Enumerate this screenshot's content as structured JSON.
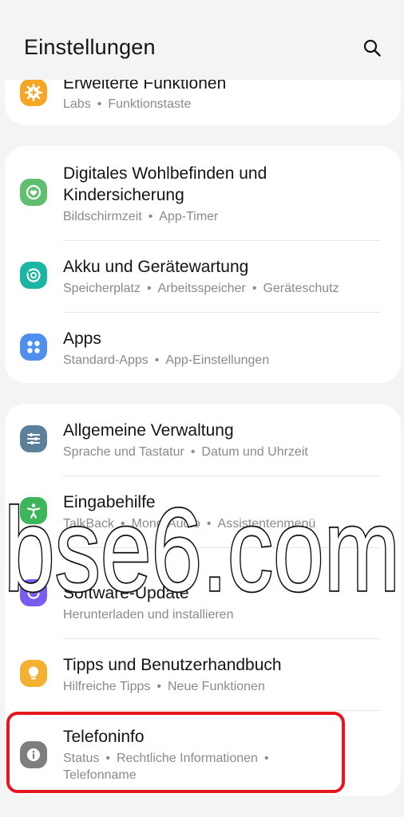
{
  "header": {
    "title": "Einstellungen",
    "search_icon": "search-icon"
  },
  "card1": {
    "item": {
      "label": "Erweiterte Funktionen",
      "subs": [
        "Labs",
        "Funktionstaste"
      ],
      "icon": "gear-plus-icon",
      "color": "#f5a623"
    }
  },
  "card2": {
    "items": [
      {
        "label_line1": "Digitales Wohlbefinden und",
        "label_line2": "Kindersicherung",
        "subs": [
          "Bildschirmzeit",
          "App-Timer"
        ],
        "icon": "wellbeing-icon",
        "color": "#5fbf6f"
      },
      {
        "label": "Akku und Gerätewartung",
        "subs": [
          "Speicherplatz",
          "Arbeitsspeicher",
          "Geräteschutz"
        ],
        "icon": "device-care-icon",
        "color": "#1bb5a3"
      },
      {
        "label": "Apps",
        "subs": [
          "Standard-Apps",
          "App-Einstellungen"
        ],
        "icon": "apps-icon",
        "color": "#4f8ff0"
      }
    ]
  },
  "card3": {
    "items": [
      {
        "label": "Allgemeine Verwaltung",
        "subs": [
          "Sprache und Tastatur",
          "Datum und Uhrzeit"
        ],
        "icon": "sliders-icon",
        "color": "#5c7f9a"
      },
      {
        "label": "Eingabehilfe",
        "subs": [
          "TalkBack",
          "Mono-Audio",
          "Assistentenmenü"
        ],
        "icon": "accessibility-icon",
        "color": "#3db55a"
      },
      {
        "label": "Software-Update",
        "subs": [
          "Herunterladen und installieren"
        ],
        "icon": "update-icon",
        "color": "#7a5cf0"
      },
      {
        "label": "Tipps und Benutzerhandbuch",
        "subs": [
          "Hilfreiche Tipps",
          "Neue Funktionen"
        ],
        "icon": "tips-icon",
        "color": "#f4b030"
      },
      {
        "label": "Telefoninfo",
        "subs_line1": [
          "Status",
          "Rechtliche Informationen"
        ],
        "subs_line2": "Telefonname",
        "icon": "info-icon",
        "color": "#7e7e7e"
      }
    ]
  },
  "watermark": {
    "text": "bse6.com"
  }
}
